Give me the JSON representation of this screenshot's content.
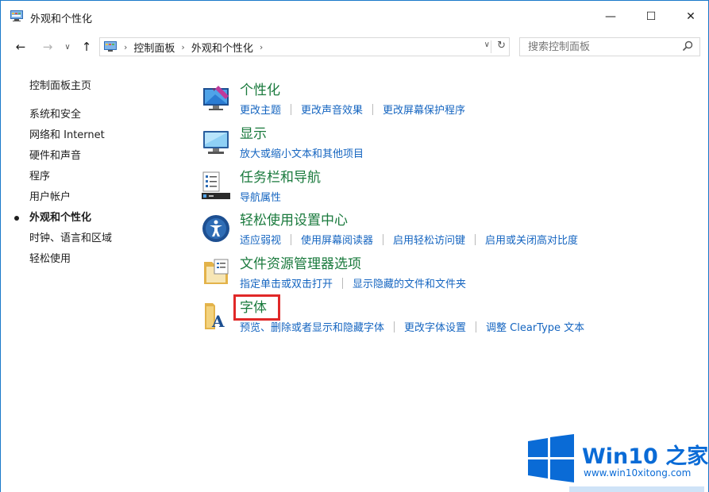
{
  "window": {
    "title": "外观和个性化",
    "minimize": "—",
    "maximize": "☐",
    "close": "✕"
  },
  "nav": {
    "back": "←",
    "forward": "→",
    "recent": "∨",
    "up": "↑",
    "breadcrumbs": [
      "控制面板",
      "外观和个性化"
    ],
    "dropdown": "∨",
    "refresh": "↻",
    "search_placeholder": "搜索控制面板"
  },
  "leftnav": {
    "home": "控制面板主页",
    "items": [
      "系统和安全",
      "网络和 Internet",
      "硬件和声音",
      "程序",
      "用户帐户",
      "外观和个性化",
      "时钟、语言和区域",
      "轻松使用"
    ],
    "active_index": 5
  },
  "categories": [
    {
      "title": "个性化",
      "icon": "personalization-icon",
      "links": [
        "更改主题",
        "更改声音效果",
        "更改屏幕保护程序"
      ]
    },
    {
      "title": "显示",
      "icon": "display-icon",
      "links": [
        "放大或缩小文本和其他项目"
      ]
    },
    {
      "title": "任务栏和导航",
      "icon": "taskbar-icon",
      "links": [
        "导航属性"
      ]
    },
    {
      "title": "轻松使用设置中心",
      "icon": "ease-of-access-icon",
      "links": [
        "适应弱视",
        "使用屏幕阅读器",
        "启用轻松访问键",
        "启用或关闭高对比度"
      ]
    },
    {
      "title": "文件资源管理器选项",
      "icon": "folder-options-icon",
      "links": [
        "指定单击或双击打开",
        "显示隐藏的文件和文件夹"
      ]
    },
    {
      "title": "字体",
      "icon": "fonts-icon",
      "links": [
        "预览、删除或者显示和隐藏字体",
        "更改字体设置",
        "调整 ClearType 文本"
      ]
    }
  ],
  "watermark": {
    "brand": "Win10 之家",
    "site": "www.win10xitong.com"
  },
  "colors": {
    "title_green": "#1a7a3d",
    "link_blue": "#1565c0",
    "highlight_red": "#e02828",
    "border_blue": "#1979ca"
  }
}
